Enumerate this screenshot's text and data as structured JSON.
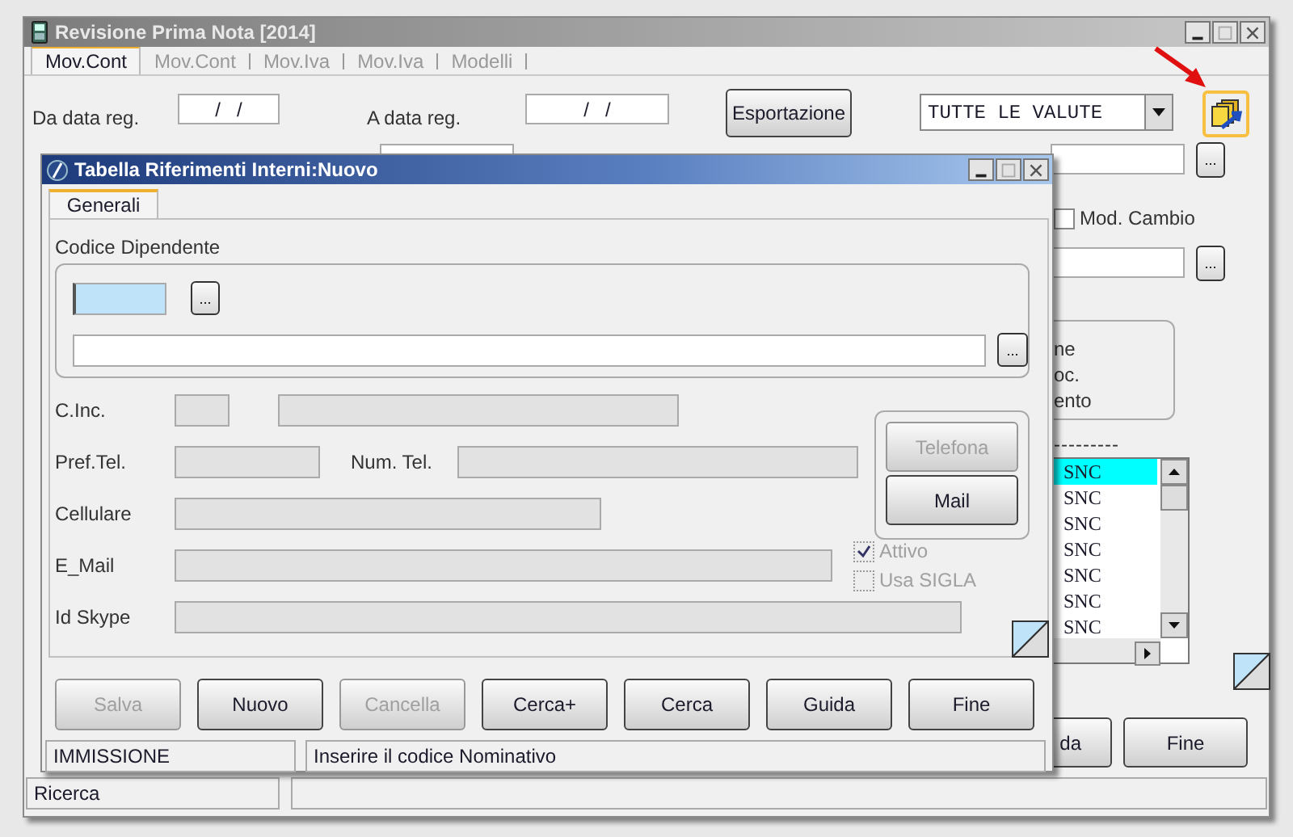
{
  "main_window": {
    "title": "Revisione Prima Nota [2014]",
    "tabs": [
      {
        "label": "Mov.Cont",
        "selected": true
      },
      {
        "label": "Mov.Cont",
        "selected": false
      },
      {
        "label": "Mov.Iva",
        "selected": false
      },
      {
        "label": "Mov.Iva",
        "selected": false
      },
      {
        "label": "Modelli",
        "selected": false
      }
    ],
    "date_from": {
      "label": "Da data reg.",
      "value": "/   /"
    },
    "date_to": {
      "label": "A data reg.",
      "value": "/   /"
    },
    "export_button": "Esportazione",
    "browse_buttons": [
      "...",
      "..."
    ],
    "currency_select": {
      "value": "TUTTE LE VALUTE"
    },
    "mod_cambio": {
      "label": "Mod. Cambio",
      "checked": false
    },
    "options_group": [
      "ne",
      "oc.",
      "ento"
    ],
    "separator_text": "---------",
    "list_rows": [
      {
        "text": "SNC",
        "selected": true
      },
      {
        "text": "SNC",
        "selected": false
      },
      {
        "text": "SNC",
        "selected": false
      },
      {
        "text": "SNC",
        "selected": false
      },
      {
        "text": "SNC",
        "selected": false
      },
      {
        "text": "SNC",
        "selected": false
      },
      {
        "text": "SNC",
        "selected": false
      }
    ],
    "buttons": [
      "da",
      "Fine"
    ],
    "status_bar": {
      "left": "Ricerca"
    }
  },
  "dialog": {
    "title": "Tabella Riferimenti Interni:Nuovo",
    "tabs": [
      {
        "label": "Generali",
        "selected": true
      }
    ],
    "group_label": "Codice Dipendente",
    "code_field": {
      "focused": true
    },
    "browse_buttons": [
      "...",
      "..."
    ],
    "fields": [
      {
        "label": "C.Inc.",
        "disabled": true
      },
      {
        "label": "Pref.Tel.",
        "disabled": true
      },
      {
        "label": "Num. Tel.",
        "disabled": true
      },
      {
        "label": "Cellulare",
        "disabled": true
      },
      {
        "label": "E_Mail",
        "disabled": true
      },
      {
        "label": "Id Skype",
        "disabled": true
      }
    ],
    "checkboxes": [
      {
        "label": "Attivo",
        "checked": true,
        "disabled": true
      },
      {
        "label": "Usa SIGLA",
        "checked": false,
        "disabled": true
      }
    ],
    "side_buttons": [
      {
        "label": "Telefona",
        "disabled": true
      },
      {
        "label": "Mail",
        "disabled": false
      }
    ],
    "buttons": [
      {
        "label": "Salva",
        "disabled": true
      },
      {
        "label": "Nuovo",
        "disabled": false
      },
      {
        "label": "Cancella",
        "disabled": true
      },
      {
        "label": "Cerca+",
        "disabled": false
      },
      {
        "label": "Cerca",
        "disabled": false
      },
      {
        "label": "Guida",
        "disabled": false
      },
      {
        "label": "Fine",
        "disabled": false
      }
    ],
    "status_bar": [
      "IMMISSIONE",
      "Inserire il codice Nominativo"
    ]
  }
}
